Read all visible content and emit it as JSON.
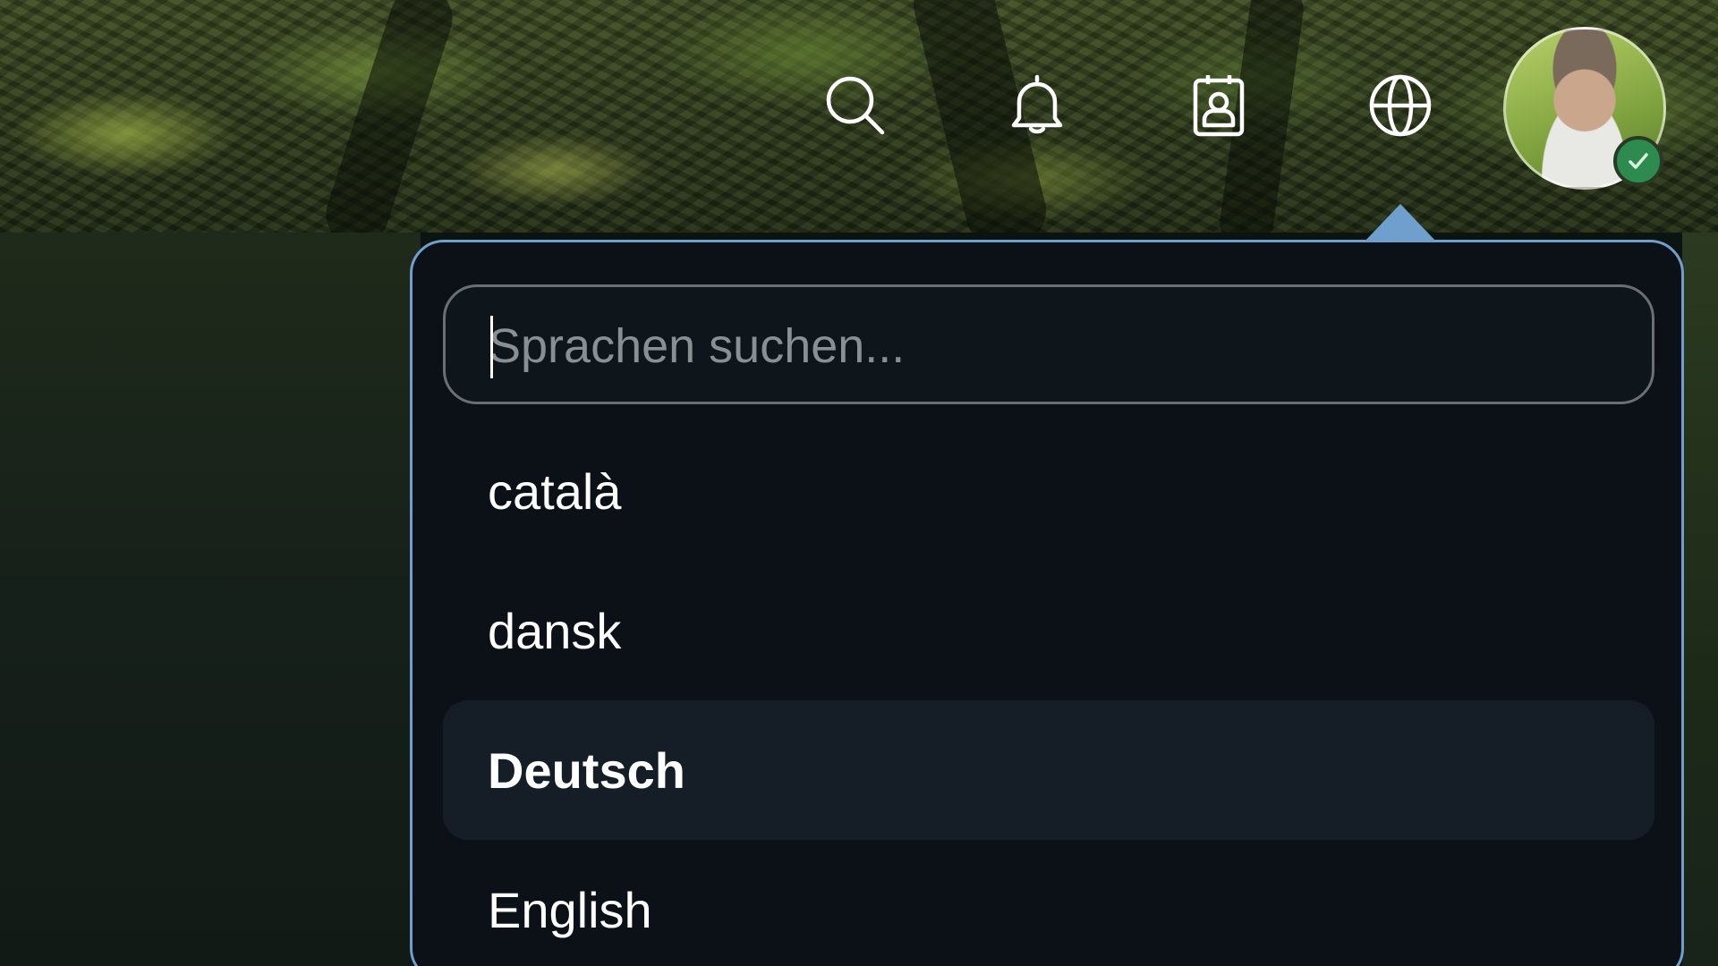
{
  "header": {
    "icons": [
      {
        "name": "search-icon"
      },
      {
        "name": "bell-icon"
      },
      {
        "name": "contact-card-icon"
      },
      {
        "name": "globe-icon"
      }
    ],
    "avatar": {
      "status": "verified",
      "status_color": "#2e8b50"
    }
  },
  "language_dropdown": {
    "search": {
      "placeholder": "Sprachen suchen...",
      "value": ""
    },
    "languages": [
      {
        "label": "català",
        "selected": false
      },
      {
        "label": "dansk",
        "selected": false
      },
      {
        "label": "Deutsch",
        "selected": true
      },
      {
        "label": "English",
        "selected": false
      }
    ],
    "accent_color": "#6f9fcc"
  }
}
